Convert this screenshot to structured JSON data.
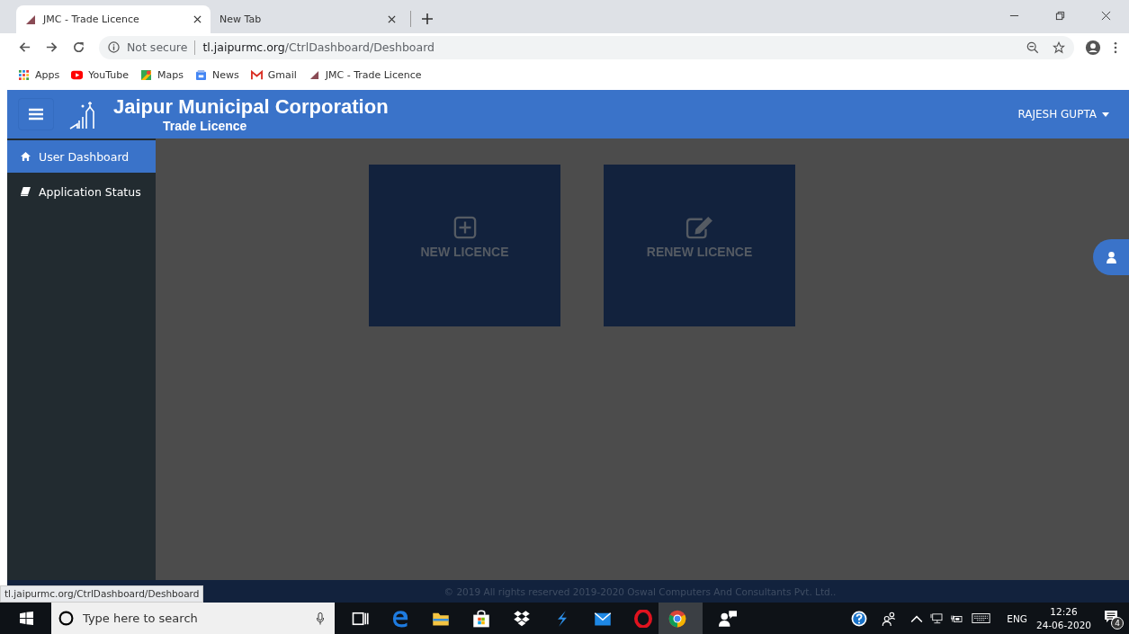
{
  "browser": {
    "tabs": [
      {
        "title": "JMC - Trade Licence",
        "selected": true,
        "kind": "site"
      },
      {
        "title": "New Tab",
        "selected": false,
        "kind": "blank"
      }
    ],
    "address": {
      "security": "Not secure",
      "host": "tl.jaipurmc.org",
      "path": "/CtrlDashboard/Deshboard"
    },
    "bookmarks": [
      {
        "label": "Apps",
        "kind": "apps"
      },
      {
        "label": "YouTube",
        "kind": "youtube"
      },
      {
        "label": "Maps",
        "kind": "maps"
      },
      {
        "label": "News",
        "kind": "news"
      },
      {
        "label": "Gmail",
        "kind": "gmail"
      },
      {
        "label": "JMC - Trade Licence",
        "kind": "site"
      }
    ]
  },
  "header": {
    "title": "Jaipur Municipal Corporation",
    "subtitle": "Trade Licence",
    "user": "RAJESH GUPTA"
  },
  "sidebar": {
    "items": [
      {
        "label": "User Dashboard",
        "selected": true,
        "kind": "home"
      },
      {
        "label": "Application Status",
        "selected": false,
        "kind": "book"
      }
    ]
  },
  "tiles": [
    {
      "label": "NEW LICENCE",
      "kind": "new"
    },
    {
      "label": "RENEW LICENCE",
      "kind": "renew"
    }
  ],
  "footer": "© 2019 All rights reserved 2019-2020 Oswal Computers And Consultants Pvt. Ltd..",
  "status_url": "tl.jaipurmc.org/CtrlDashboard/Deshboard",
  "taskbar": {
    "search_placeholder": "Type here to search",
    "language": "ENG",
    "time": "12:26",
    "date": "24-06-2020",
    "notifications": "4"
  }
}
